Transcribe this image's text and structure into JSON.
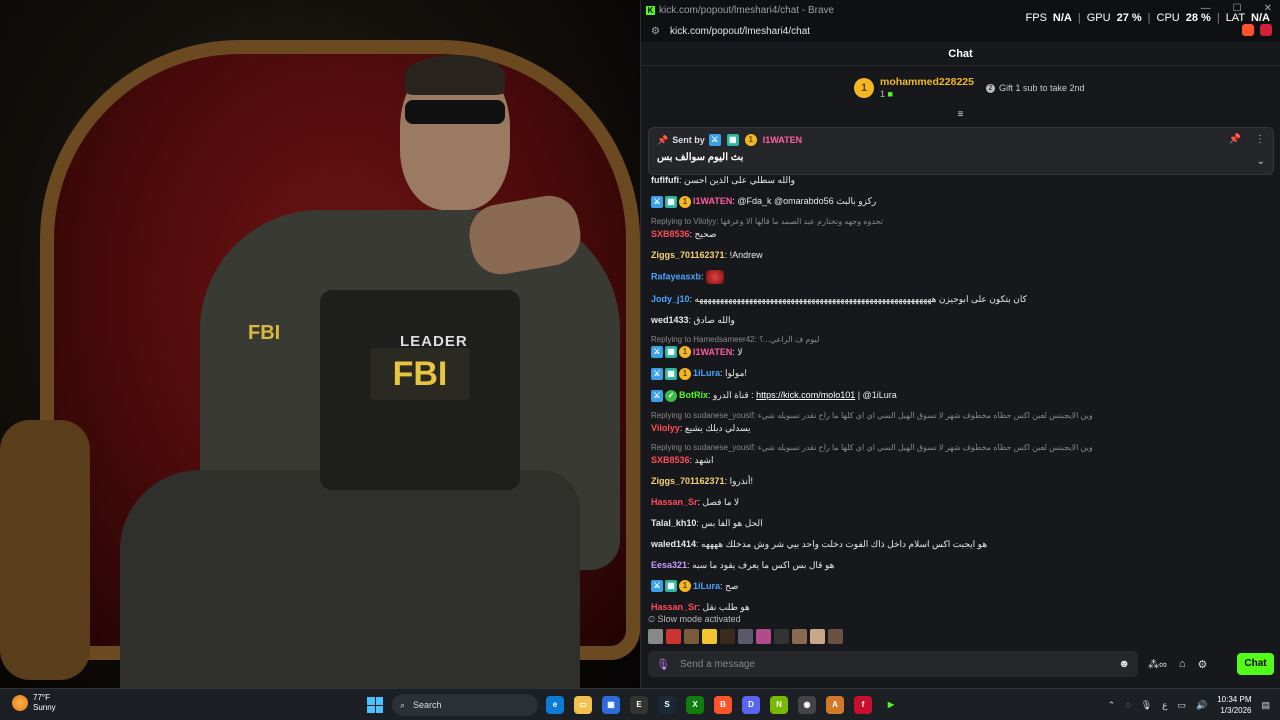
{
  "browser": {
    "window_title": "kick.com/popout/lmeshari4/chat - Brave",
    "url": "kick.com/popout/lmeshari4/chat",
    "window_controls": {
      "minimize": "—",
      "maximize": "☐",
      "close": "✕"
    }
  },
  "overlay": {
    "fps_label": "FPS",
    "fps_value": "N/A",
    "gpu_label": "GPU",
    "gpu_value": "27 %",
    "cpu_label": "CPU",
    "cpu_value": "28 %",
    "lat_label": "LAT",
    "lat_value": "N/A"
  },
  "chat": {
    "header": "Chat",
    "leaderboard": {
      "rank": "1",
      "name": "mohammed228225",
      "count": "1",
      "gift_text": "Gift 1 sub to take 2nd"
    },
    "pinned": {
      "sent_by_label": "Sent by",
      "user": "I1WATEN",
      "message": "بث اليوم سوالف بس"
    },
    "messages": [
      {
        "user": "fufifufi",
        "color": "#e8e8e8",
        "text": "والله سطلي على الذين احسن",
        "badges": []
      },
      {
        "user": "I1WATEN",
        "color": "#ff5ea0",
        "text": "@Fda_k @omarabdo56 ركزو بالبث",
        "badges": [
          "blue",
          "teal",
          "gold"
        ]
      },
      {
        "reply": "Replying to Vilolyy: تحدوه وجهه وتختارم عبد الصمد ما قالها الا وعرفها",
        "user": "SXB8536",
        "color": "#ff4b5c",
        "text": "صحيح",
        "badges": []
      },
      {
        "user": "Ziggs_701162371",
        "color": "#f4d47a",
        "text": "!Andrew",
        "badges": []
      },
      {
        "user": "Rafayeasxb",
        "color": "#4aa3ff",
        "text": "",
        "emote": true,
        "badges": []
      },
      {
        "user": "Jody_j10",
        "color": "#4aa3ff",
        "text": "كان بتكون على ابوجيزن هههههههههههههههههههههههههههههههههههههههههههههههههههههههههه",
        "badges": []
      },
      {
        "user": "wed1433",
        "color": "#e8e8e8",
        "text": "والله صادق",
        "badges": []
      },
      {
        "reply": "Replying to Hamedsameer42: ليوم ف الراعي...؟",
        "user": "I1WATEN",
        "color": "#ff5ea0",
        "text": "لا",
        "badges": [
          "blue",
          "teal",
          "gold"
        ]
      },
      {
        "user": "1iLura",
        "color": "#4aa3ff",
        "text": "مولوا!",
        "badges": [
          "blue",
          "teal",
          "gold"
        ]
      },
      {
        "user": "BotRix",
        "color": "#53fc18",
        "text": "قناة الدرو : ",
        "link": "https://kick.com/molo101",
        "after": " | @1iLura",
        "badges": [
          "blue",
          "green"
        ]
      },
      {
        "reply": "Replying to sudanese_yousif: وين الايجبتس لعبن اكس حظاه مخطوف شهر لا تسوق الهيل السي اي اي كلها ما راح تقدر تسويله شيء",
        "user": "Vilolyy",
        "color": "#ff4b5c",
        "text": "يسدلي ديلك يشيع",
        "badges": []
      },
      {
        "reply": "Replying to sudanese_yousif: وين الايجبتس لعبن اكس حظاه مخطوف شهر لا تسوق الهيل السي اي اي كلها ما راح تقدر تسويله شيء",
        "user": "SXB8536",
        "color": "#ff4b5c",
        "text": "اشهد",
        "badges": []
      },
      {
        "user": "Ziggs_701162371",
        "color": "#f4d47a",
        "text": "أنذروا!",
        "badges": []
      },
      {
        "user": "Hassan_Sr",
        "color": "#ff4b5c",
        "text": "لا ما فصل",
        "badges": []
      },
      {
        "user": "Talal_kh10",
        "color": "#e8e8e8",
        "text": "الحل هو الفا بس",
        "badges": []
      },
      {
        "user": "waled1414",
        "color": "#e8e8e8",
        "text": "هو ايجبت اكس اسلام داخل ذاك الفوت دخلت واحد بيي شر وش مدخلك ههههه",
        "badges": []
      },
      {
        "user": "Eesa321",
        "color": "#c79bff",
        "text": "هو قال بس اكس ما يعرف يقود ما سبه",
        "badges": []
      },
      {
        "user": "1iLura",
        "color": "#4aa3ff",
        "text": "صح",
        "badges": [
          "blue",
          "teal",
          "gold"
        ]
      },
      {
        "user": "Hassan_Sr",
        "color": "#ff4b5c",
        "text": "هو طلب نقل",
        "badges": []
      }
    ],
    "slow_mode": "Slow mode activated",
    "input_placeholder": "Send a message",
    "chat_button": "Chat"
  },
  "desktop": {
    "patch_leader": "LEADER",
    "patch_fbi": "FBI",
    "patch_fbi_arm": "FBI"
  },
  "taskbar": {
    "weather_temp": "77°F",
    "weather_desc": "Sunny",
    "search_label": "Search",
    "time": "10:34 PM",
    "date": "1/3/2026",
    "lang": "ع"
  }
}
